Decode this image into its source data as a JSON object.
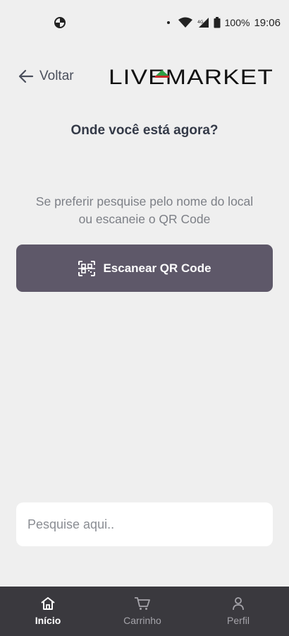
{
  "status_bar": {
    "battery": "100%",
    "time": "19:06"
  },
  "header": {
    "back_label": "Voltar",
    "logo_text": "LIVEMARKET"
  },
  "main": {
    "title": "Onde você está agora?",
    "subtitle": "Se preferir pesquise pelo nome do local ou escaneie o QR Code",
    "scan_button_label": "Escanear QR Code"
  },
  "search": {
    "placeholder": "Pesquise aqui..",
    "value": ""
  },
  "bottom_nav": {
    "items": [
      {
        "label": "Início",
        "icon": "home-icon",
        "active": true
      },
      {
        "label": "Carrinho",
        "icon": "cart-icon",
        "active": false
      },
      {
        "label": "Perfil",
        "icon": "user-icon",
        "active": false
      }
    ]
  },
  "colors": {
    "background": "#efefef",
    "primary_button": "#5e5869",
    "nav_background": "#3a393e",
    "logo_accent_red": "#c62828",
    "logo_accent_green": "#2e9e44"
  }
}
